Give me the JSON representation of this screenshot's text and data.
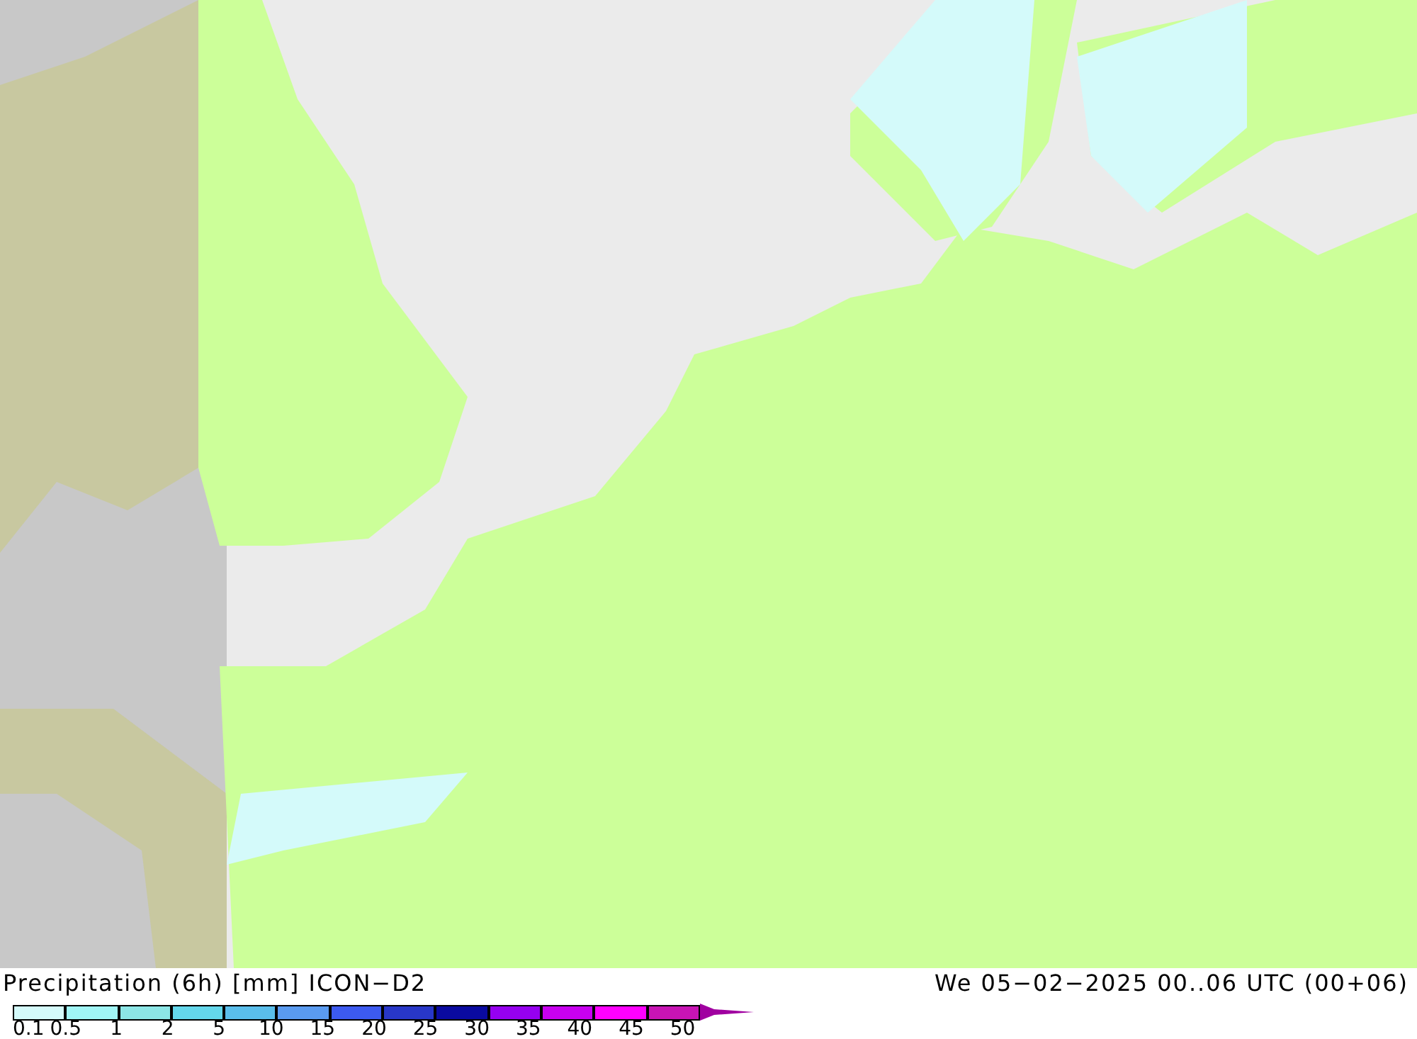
{
  "legend": {
    "title": "Precipitation (6h) [mm] ICON−D2",
    "valid_time": "We 05−02−2025 00..06 UTC (00+06)",
    "bins": [
      {
        "color": "#d4fafa"
      },
      {
        "color": "#a0f5f5"
      },
      {
        "color": "#8ce6e6"
      },
      {
        "color": "#64d7eb"
      },
      {
        "color": "#5abeeb"
      },
      {
        "color": "#5a9bf0"
      },
      {
        "color": "#3c5af0"
      },
      {
        "color": "#2837c8"
      },
      {
        "color": "#0a0aa0"
      },
      {
        "color": "#9600f0"
      },
      {
        "color": "#c800f0"
      },
      {
        "color": "#ff00ff"
      },
      {
        "color": "#c814b4"
      }
    ],
    "ticks": [
      "0.1",
      "0.5",
      "1",
      "2",
      "5",
      "10",
      "15",
      "20",
      "25",
      "30",
      "35",
      "40",
      "45",
      "50"
    ],
    "overflow": {
      "color": "#a000a0"
    }
  }
}
